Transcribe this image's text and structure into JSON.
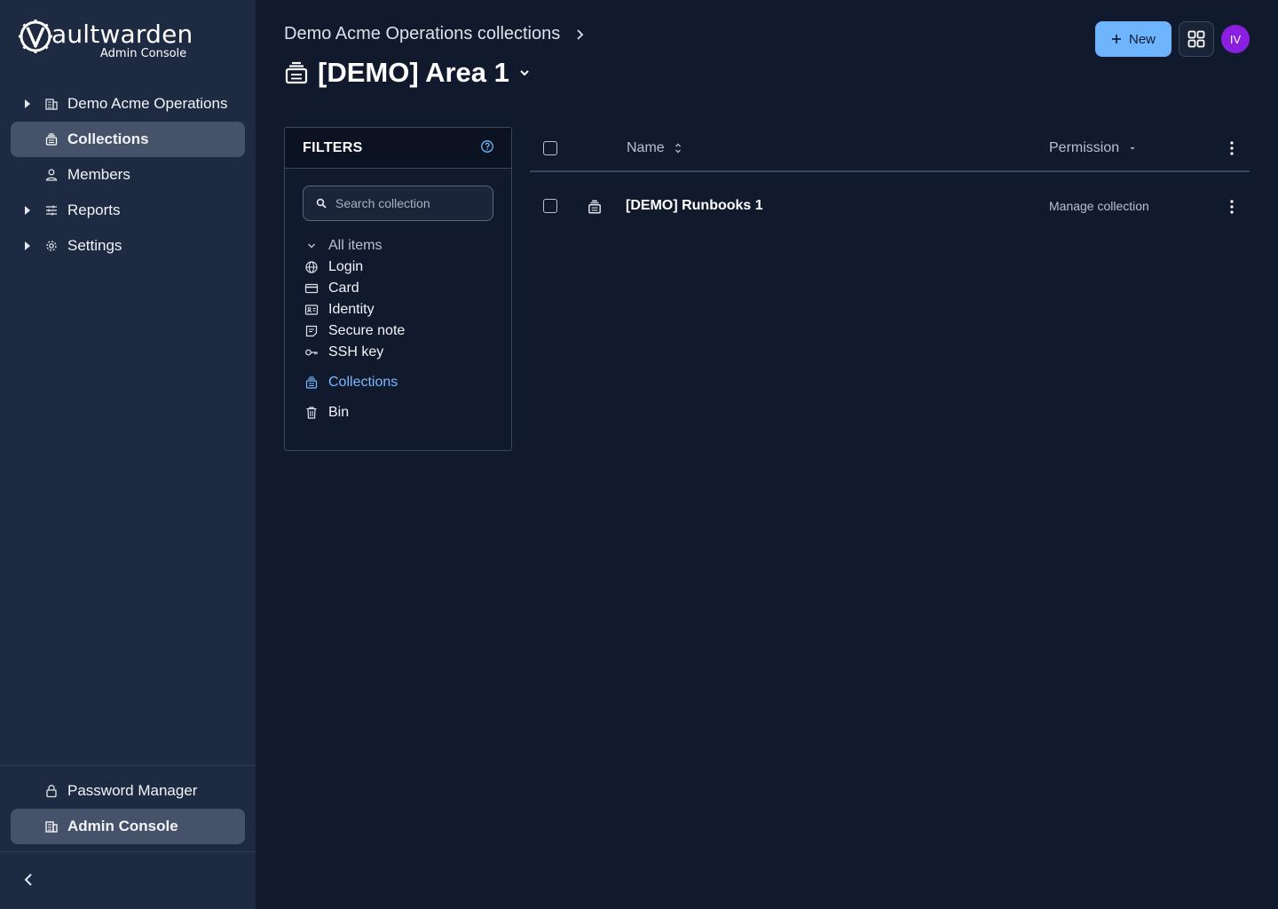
{
  "app": {
    "brand": "aultwarden",
    "brand_sub": "Admin Console"
  },
  "sidebar": {
    "items": [
      {
        "label": "Demo Acme Operations",
        "icon": "building-icon",
        "expandable": true
      },
      {
        "label": "Collections",
        "icon": "collection-icon",
        "active": true
      },
      {
        "label": "Members",
        "icon": "user-icon"
      },
      {
        "label": "Reports",
        "icon": "sliders-icon",
        "expandable": true
      },
      {
        "label": "Settings",
        "icon": "gear-icon",
        "expandable": true
      }
    ],
    "footer": [
      {
        "label": "Password Manager",
        "icon": "lock-icon"
      },
      {
        "label": "Admin Console",
        "icon": "building-icon",
        "active": true
      }
    ]
  },
  "header": {
    "breadcrumb": "Demo Acme Operations collections",
    "title": "[DEMO] Area 1",
    "new_label": "New",
    "avatar_initials": "IV",
    "avatar_color": "#8b1fe0",
    "accent_color": "#6eb4ff"
  },
  "filters": {
    "title": "FILTERS",
    "search_placeholder": "Search collection",
    "items": [
      {
        "label": "All items",
        "icon": "chevron-down-icon"
      },
      {
        "label": "Login",
        "icon": "globe-icon"
      },
      {
        "label": "Card",
        "icon": "credit-card-icon"
      },
      {
        "label": "Identity",
        "icon": "id-card-icon"
      },
      {
        "label": "Secure note",
        "icon": "note-icon"
      },
      {
        "label": "SSH key",
        "icon": "key-icon"
      },
      {
        "label": "Collections",
        "icon": "collection-icon",
        "active": true
      },
      {
        "label": "Bin",
        "icon": "trash-icon"
      }
    ]
  },
  "table": {
    "columns": {
      "name": "Name",
      "permission": "Permission"
    },
    "rows": [
      {
        "name": "[DEMO] Runbooks 1",
        "permission": "Manage collection",
        "icon": "collection-icon"
      }
    ]
  }
}
